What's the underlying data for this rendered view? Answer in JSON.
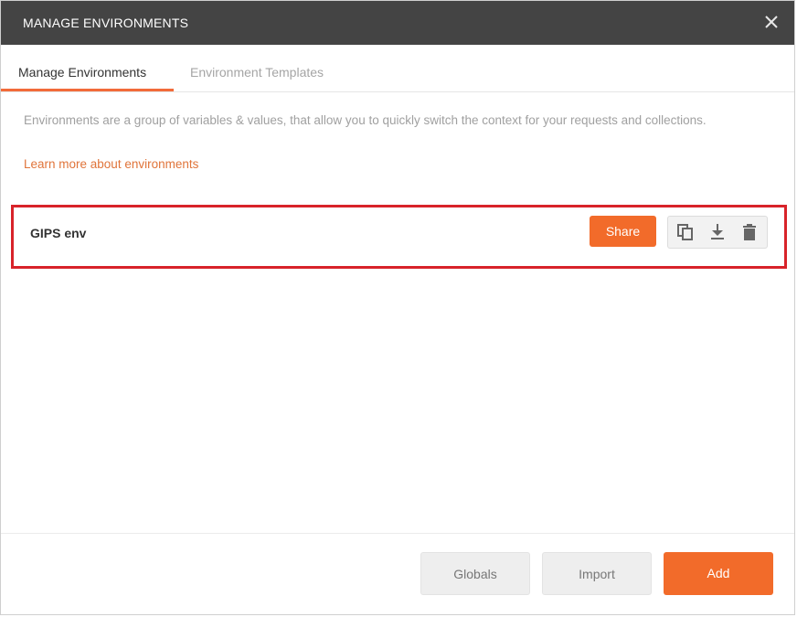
{
  "modal": {
    "title": "MANAGE ENVIRONMENTS",
    "close_icon": "close-icon"
  },
  "tabs": [
    {
      "label": "Manage Environments",
      "active": true
    },
    {
      "label": "Environment Templates",
      "active": false
    }
  ],
  "content": {
    "description": "Environments are a group of variables & values, that allow you to quickly switch the context for your requests and collections.",
    "learn_more_link": "Learn more about environments"
  },
  "environments": [
    {
      "name": "GIPS env",
      "share_label": "Share",
      "actions": [
        "duplicate-icon",
        "download-icon",
        "delete-icon"
      ]
    }
  ],
  "footer": {
    "globals_label": "Globals",
    "import_label": "Import",
    "add_label": "Add"
  },
  "colors": {
    "accent": "#f26b2a",
    "header_bg": "#444444",
    "highlight_border": "#d8232a",
    "link": "#e0743a"
  }
}
